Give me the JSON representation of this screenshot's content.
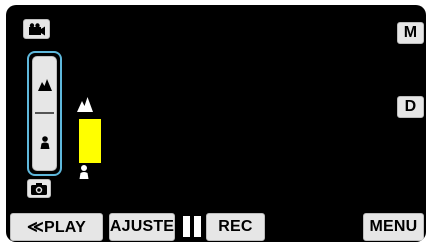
{
  "top_left": {
    "mode_icon": "video-camera-icon"
  },
  "top_right": {
    "m_label": "M",
    "d_label": "D"
  },
  "focus_panel": {
    "far_icon": "mountain-far-icon",
    "near_icon": "person-near-icon",
    "camera_icon": "camera-icon",
    "indicator": {
      "far_icon": "mountain-far-icon",
      "near_icon": "person-near-icon",
      "level_fraction": 0.45
    }
  },
  "bottom_bar": {
    "play_label": "≪PLAY",
    "adjust_label": "AJUSTE",
    "rec_label": "REC",
    "menu_label": "MENU"
  },
  "colors": {
    "accent_blue": "#5fb8dc",
    "indicator_yellow": "#ffff00",
    "button_bg": "#e6e6e6",
    "screen_bg": "#000000"
  }
}
